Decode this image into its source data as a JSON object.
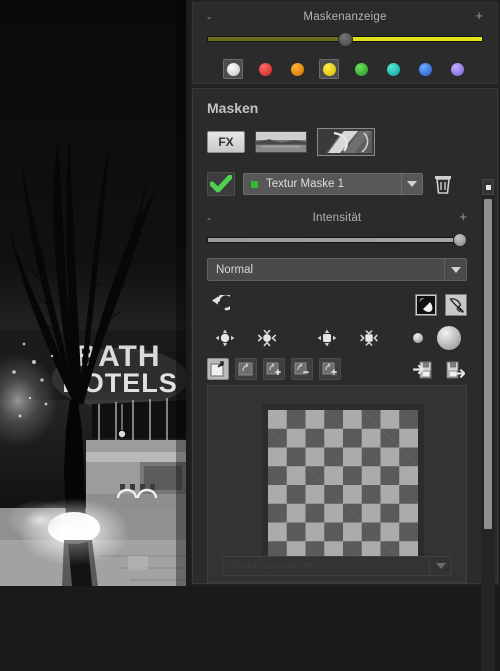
{
  "photo": {
    "alt": "black-and-white night photo of palm tree in front of illuminated hotel sign",
    "sign_line1": "BATH",
    "sign_line2": "HOTELS"
  },
  "mask_display_panel": {
    "slider": {
      "title": "Maskenanzeige",
      "minus_label": "-",
      "plus_label": "+",
      "value_percent": 50
    },
    "color_swatches": [
      {
        "name": "white",
        "hex": "#e9e9e9",
        "selected": true
      },
      {
        "name": "red",
        "hex": "#e8403c",
        "selected": false
      },
      {
        "name": "orange",
        "hex": "#f08c0e",
        "selected": false
      },
      {
        "name": "yellow",
        "hex": "#e7d41a",
        "selected": true
      },
      {
        "name": "green",
        "hex": "#3fb83a",
        "selected": false
      },
      {
        "name": "teal",
        "hex": "#22c0b4",
        "selected": false
      },
      {
        "name": "blue",
        "hex": "#3a7fe8",
        "selected": false
      },
      {
        "name": "purple",
        "hex": "#9b84ea",
        "selected": false
      }
    ]
  },
  "masks_panel": {
    "title": "Masken",
    "fx_button_label": "FX",
    "thumbnails": [
      {
        "name": "landscape-thumbnail",
        "selected": false
      },
      {
        "name": "texture-thumbnail",
        "selected": true
      }
    ],
    "mask_row": {
      "enabled_icon": "green-checkmark",
      "marker_color": "#2fbd2f",
      "selected_mask": "Textur Maske 1",
      "delete_icon": "trash-icon"
    },
    "intensity": {
      "title": "Intensität",
      "minus_label": "-",
      "plus_label": "+",
      "value_percent": 100
    },
    "blend_mode": {
      "selected": "Normal"
    },
    "tools_row1": {
      "left": [
        {
          "name": "reset-mask-icon"
        }
      ],
      "right": [
        {
          "name": "invert-mask-icon"
        },
        {
          "name": "brush-eraser-icon"
        }
      ]
    },
    "tools_row2": {
      "group_a": [
        {
          "name": "decrease-feather-icon"
        },
        {
          "name": "increase-feather-icon"
        }
      ],
      "group_b": [
        {
          "name": "decrease-brush-size-icon"
        },
        {
          "name": "increase-brush-size-icon"
        }
      ],
      "group_c": [
        {
          "name": "small-brush-preview",
          "size": 10
        },
        {
          "name": "large-brush-preview",
          "size": 24
        }
      ]
    },
    "tools_row3": {
      "left": [
        {
          "name": "new-mask-icon",
          "active": true
        },
        {
          "name": "copy-mask-icon",
          "active": false
        },
        {
          "name": "add-mask-icon",
          "active": false
        },
        {
          "name": "subtract-mask-icon",
          "active": false
        },
        {
          "name": "intersect-mask-icon",
          "active": false
        }
      ],
      "right": [
        {
          "name": "load-mask-icon"
        },
        {
          "name": "save-mask-icon"
        }
      ]
    },
    "preview": {
      "name": "mask-checkerboard-preview",
      "squares": 8,
      "light_hex": "#ababab",
      "dark_hex": "#5a5a5a"
    },
    "preset_combo": {
      "selected": "Textur auswählen"
    }
  },
  "scrollbar": {
    "up_button": "scroll-up-button",
    "thumb": "scrollbar-thumb"
  }
}
